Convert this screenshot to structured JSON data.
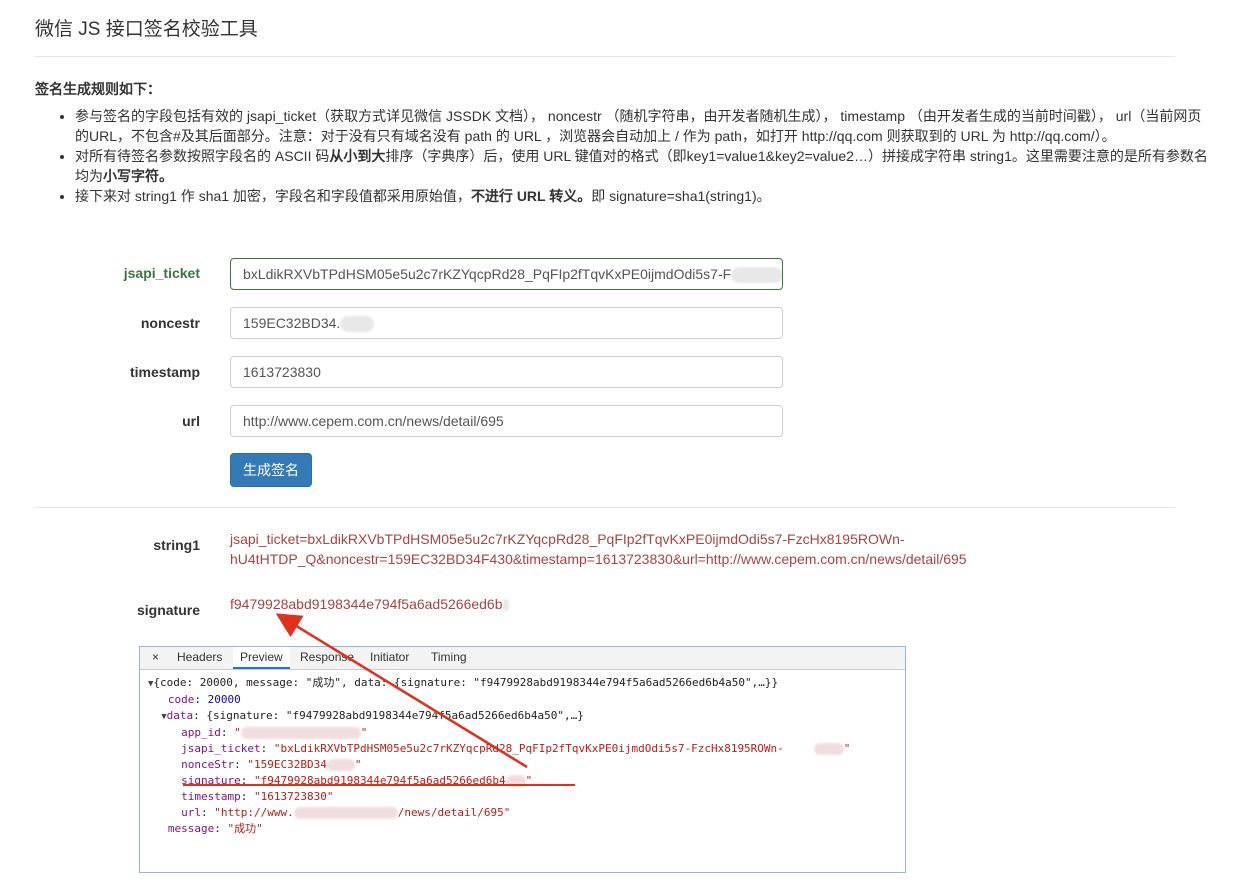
{
  "page": {
    "title": "微信 JS 接口签名校验工具"
  },
  "rules": {
    "heading": "签名生成规则如下：",
    "item1": "参与签名的字段包括有效的 jsapi_ticket（获取方式详见微信 JSSDK 文档），  noncestr （随机字符串，由开发者随机生成），  timestamp （由开发者生成的当前时间戳），  url（当前网页的URL，不包含#及其后面部分。注意：对于没有只有域名没有 path 的 URL ，浏览器会自动加上 / 作为 path，如打开 http://qq.com 则获取到的 URL 为 http://qq.com/）。",
    "item2a": "对所有待签名参数按照字段名的 ASCII 码",
    "item2b": "从小到大",
    "item2c": "排序（字典序）后，使用 URL 键值对的格式（即key1=value1&key2=value2…）拼接成字符串 string1。这里需要注意的是所有参数名均为",
    "item2d": "小写字符。",
    "item3a": "接下来对 string1 作 sha1 加密，字段名和字段值都采用原始值，",
    "item3b": "不进行 URL 转义。",
    "item3c": "即 signature=sha1(string1)。"
  },
  "form": {
    "jsapi_ticket_label": "jsapi_ticket",
    "jsapi_ticket_value": "bxLdikRXVbTPdHSM05e5u2c7rKZYqcpRd28_PqFIp2fTqvKxPE0ijmdOdi5s7-F",
    "noncestr_label": "noncestr",
    "noncestr_value": "159EC32BD34.",
    "timestamp_label": "timestamp",
    "timestamp_value": "1613723830",
    "url_label": "url",
    "url_value": "http://www.cepem.com.cn/news/detail/695",
    "submit_label": "生成签名"
  },
  "result": {
    "string1_label": "string1",
    "string1_value": "jsapi_ticket=bxLdikRXVbTPdHSM05e5u2c7rKZYqcpRd28_PqFIp2fTqvKxPE0ijmdOdi5s7-FzcHx8195ROWn-hU4tHTDP_Q&noncestr=159EC32BD34F430&timestamp=1613723830&url=http://www.cepem.com.cn/news/detail/695",
    "signature_label": "signature",
    "signature_value": "f9479928abd9198344e794f5a6ad5266ed6b"
  },
  "devtools": {
    "close_glyph": "×",
    "tabs": [
      "Headers",
      "Preview",
      "Response",
      "Initiator",
      "Timing"
    ],
    "active_tab": "Preview",
    "line0": "{code: 20000, message: \"成功\", data: {signature: \"f9479928abd9198344e794f5a6ad5266ed6b4a50\",…}}",
    "code_key": "code",
    "code_val": "20000",
    "data_key": "data",
    "data_summary": "{signature: \"f9479928abd9198344e794f5a6ad5266ed6b4a50\",…}",
    "app_id_key": "app_id",
    "jsapi_key": "jsapi_ticket",
    "jsapi_val": "\"bxLdikRXVbTPdHSM05e5u2c7rKZYqcpRd28_PqFIp2fTqvKxPE0ijmdOdi5s7-FzcHx8195ROWn-",
    "nonce_key": "nonceStr",
    "nonce_val": "\"159EC32BD34",
    "sig_key": "signature",
    "sig_val": "\"f9479928abd9198344e794f5a6ad5266ed6b4",
    "ts_key": "timestamp",
    "ts_val": "\"1613723830\"",
    "url_key": "url",
    "url_val_a": "\"http://www.",
    "url_val_b": "/news/detail/695\"",
    "msg_key": "message",
    "msg_val": "\"成功\""
  },
  "colors": {
    "primary": "#337ab7",
    "success": "#3c763d",
    "danger": "#a94442",
    "annotation": "#e0301e"
  }
}
